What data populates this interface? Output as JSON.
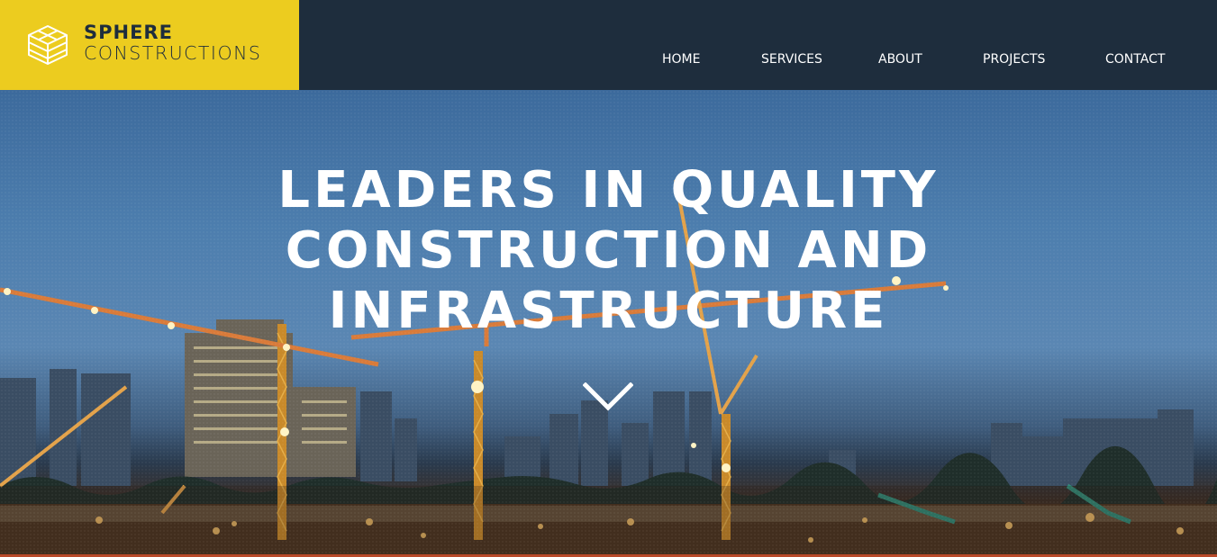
{
  "brand": {
    "line1": "SPHERE",
    "line2": "CONSTRUCTIONS",
    "logo_icon": "stacked-cube-icon",
    "accent_color": "#eccc1f",
    "header_color": "#1e2d3d"
  },
  "nav": {
    "items": [
      {
        "label": "HOME"
      },
      {
        "label": "SERVICES"
      },
      {
        "label": "ABOUT"
      },
      {
        "label": "PROJECTS"
      },
      {
        "label": "CONTACT"
      }
    ]
  },
  "hero": {
    "headline_lines": [
      "LEADERS IN QUALITY",
      "CONSTRUCTION AND",
      "INFRASTRUCTURE"
    ],
    "scroll_icon": "chevron-down-icon",
    "background": "construction-site-cranes-city-skyline-dusk"
  }
}
